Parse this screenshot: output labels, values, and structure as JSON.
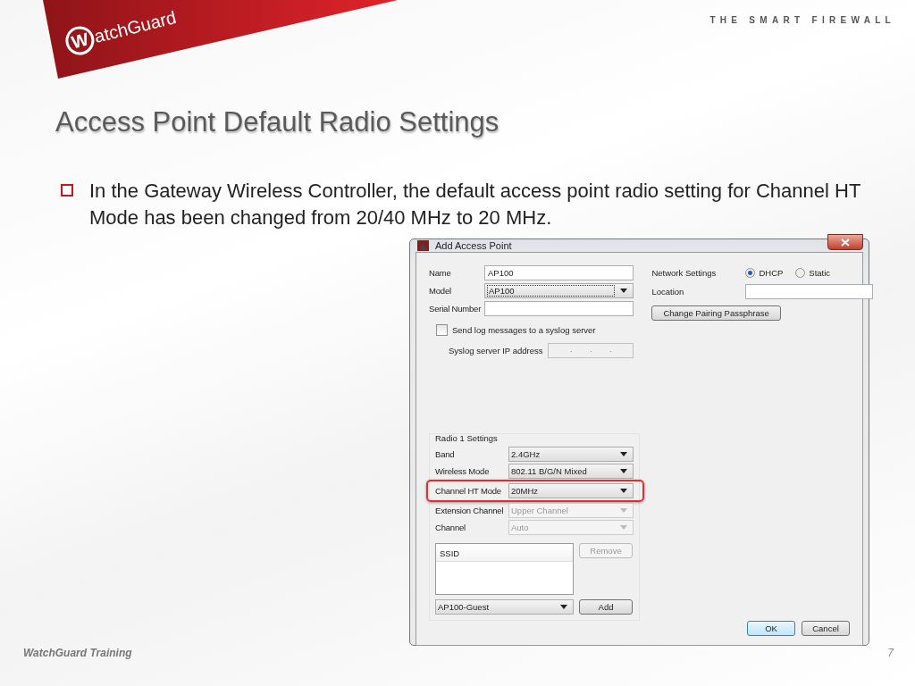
{
  "header": {
    "logo": {
      "mark": "W",
      "text": "atchGuard"
    },
    "tagline": "THE SMART FIREWALL"
  },
  "title": "Access Point Default Radio Settings",
  "bullet": "In the Gateway Wireless Controller, the default access point radio setting for Channel HT Mode has been changed from 20/40 MHz to 20 MHz.",
  "dialog": {
    "title": "Add Access Point",
    "fields": [
      {
        "label": "Name",
        "kind": "text",
        "value": "AP100"
      },
      {
        "label": "Model",
        "kind": "select",
        "value": "AP100"
      },
      {
        "label": "Serial Number",
        "kind": "text"
      }
    ],
    "syslog": {
      "label": "Send log messages to a syslog server",
      "checked": false
    },
    "syslog_ip": {
      "label": "Syslog server IP address",
      "disabled": true,
      "separators": [
        ".",
        ".",
        "."
      ]
    },
    "network": {
      "label": "Network Settings",
      "options": [
        {
          "label": "DHCP",
          "selected": true
        },
        {
          "label": "Static",
          "selected": false
        }
      ]
    },
    "location": {
      "label": "Location"
    },
    "pairing_button": "Change Pairing Passphrase",
    "radio": {
      "title": "Radio 1 Settings",
      "rows": [
        {
          "label": "Band",
          "value": "2.4GHz",
          "disabled": false,
          "highlighted": false
        },
        {
          "label": "Wireless Mode",
          "value": "802.11 B/G/N Mixed",
          "disabled": false,
          "highlighted": false
        },
        {
          "label": "Channel HT Mode",
          "value": "20MHz",
          "disabled": false,
          "highlighted": true
        },
        {
          "label": "Extension Channel",
          "value": "Upper Channel",
          "disabled": true,
          "highlighted": false
        },
        {
          "label": "Channel",
          "value": "Auto",
          "disabled": true,
          "highlighted": false
        }
      ],
      "ssid_header": "SSID",
      "remove_button": {
        "label": "Remove",
        "disabled": true
      },
      "ssid_select": "AP100-Guest",
      "add_button": {
        "label": "Add",
        "disabled": false
      }
    },
    "buttons": [
      {
        "label": "OK",
        "default": true
      },
      {
        "label": "Cancel",
        "default": false
      }
    ]
  },
  "footer": {
    "left": "WatchGuard Training",
    "page": "7"
  }
}
